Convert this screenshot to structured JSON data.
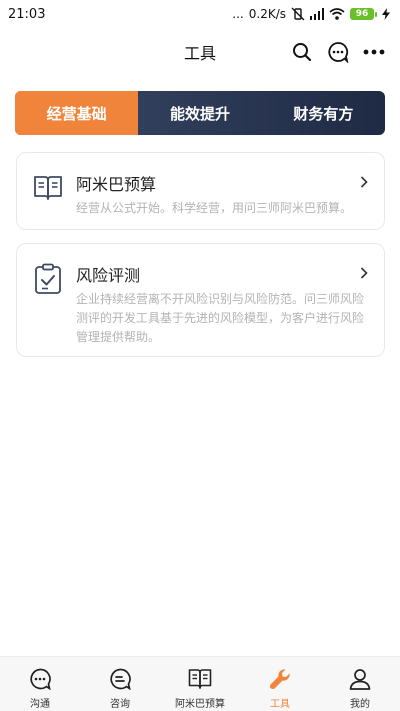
{
  "status": {
    "time": "21:03",
    "network_speed": "0.2K/s",
    "battery": "96"
  },
  "nav": {
    "title": "工具"
  },
  "tabs": [
    {
      "label": "经营基础"
    },
    {
      "label": "能效提升"
    },
    {
      "label": "财务有方"
    }
  ],
  "cards": [
    {
      "title": "阿米巴预算",
      "desc": "经营从公式开始。科学经营，用问三师阿米巴预算。",
      "icon": "book-icon"
    },
    {
      "title": "风险评测",
      "desc": "企业持续经营离不开风险识别与风险防范。问三师风险测评的开发工具基于先进的风险模型，为客户进行风险管理提供帮助。",
      "icon": "clipboard-check-icon"
    }
  ],
  "tabbar": [
    {
      "label": "沟通",
      "icon": "chat-bubble-icon"
    },
    {
      "label": "咨询",
      "icon": "consult-icon"
    },
    {
      "label": "阿米巴预算",
      "icon": "book-icon"
    },
    {
      "label": "工具",
      "icon": "wrench-icon"
    },
    {
      "label": "我的",
      "icon": "person-icon"
    }
  ],
  "colors": {
    "accent": "#f0843a",
    "tab_bg": "#2a3755"
  }
}
